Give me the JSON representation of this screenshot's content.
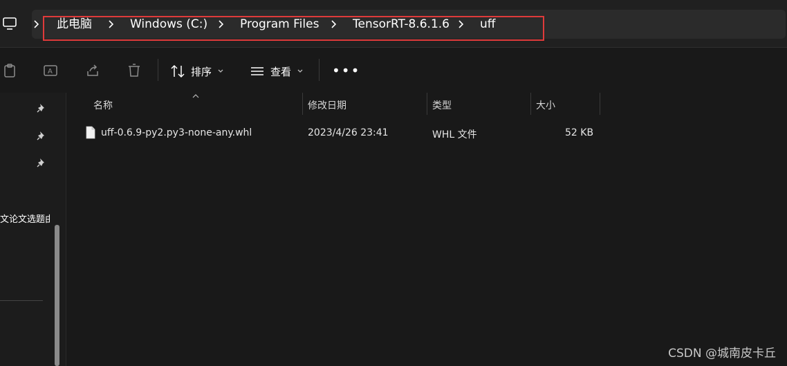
{
  "address_bar": {
    "crumbs": [
      "此电脑",
      "Windows (C:)",
      "Program Files",
      "TensorRT-8.6.1.6",
      "uff"
    ]
  },
  "toolbar": {
    "sort_label": "排序",
    "view_label": "查看",
    "more_label": "•••"
  },
  "sidebar": {
    "partial_item": "文论文选题由"
  },
  "columns": {
    "name": "名称",
    "modified": "修改日期",
    "type": "类型",
    "size": "大小"
  },
  "files": [
    {
      "name": "uff-0.6.9-py2.py3-none-any.whl",
      "modified": "2023/4/26 23:41",
      "type": "WHL 文件",
      "size": "52 KB"
    }
  ],
  "watermark": "CSDN @城南皮卡丘",
  "colors": {
    "background": "#191919",
    "highlight_border": "#e03a3a",
    "text": "#ffffff"
  }
}
